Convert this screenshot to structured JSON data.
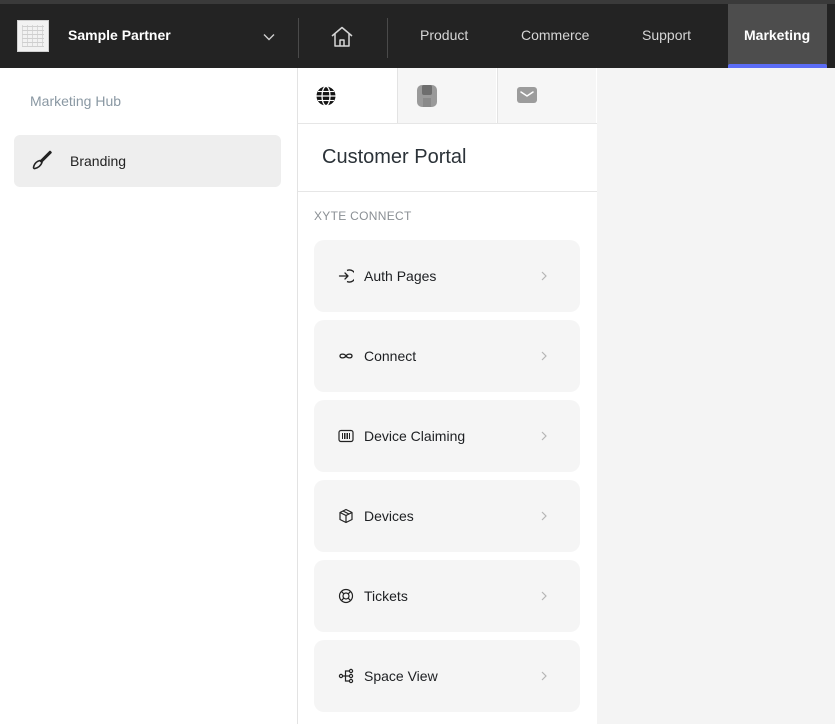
{
  "header": {
    "partner_name": "Sample Partner",
    "nav": [
      {
        "label": "Product"
      },
      {
        "label": "Commerce"
      },
      {
        "label": "Support"
      },
      {
        "label": "Marketing",
        "active": true
      }
    ],
    "accent_color": "#5b6cf5"
  },
  "sidebar": {
    "section_title": "Marketing Hub",
    "items": [
      {
        "label": "Branding",
        "icon": "brush-icon",
        "selected": true
      }
    ]
  },
  "panel": {
    "tabs": [
      {
        "icon": "globe-icon",
        "active": true
      },
      {
        "icon": "device-icon"
      },
      {
        "icon": "mail-icon"
      }
    ],
    "title": "Customer Portal",
    "section_label": "XYTE CONNECT",
    "cards": [
      {
        "label": "Auth Pages",
        "icon": "sign-in-icon"
      },
      {
        "label": "Connect",
        "icon": "infinity-icon"
      },
      {
        "label": "Device Claiming",
        "icon": "barcode-icon"
      },
      {
        "label": "Devices",
        "icon": "cube-icon"
      },
      {
        "label": "Tickets",
        "icon": "lifebuoy-icon"
      },
      {
        "label": "Space View",
        "icon": "hierarchy-icon"
      }
    ]
  }
}
